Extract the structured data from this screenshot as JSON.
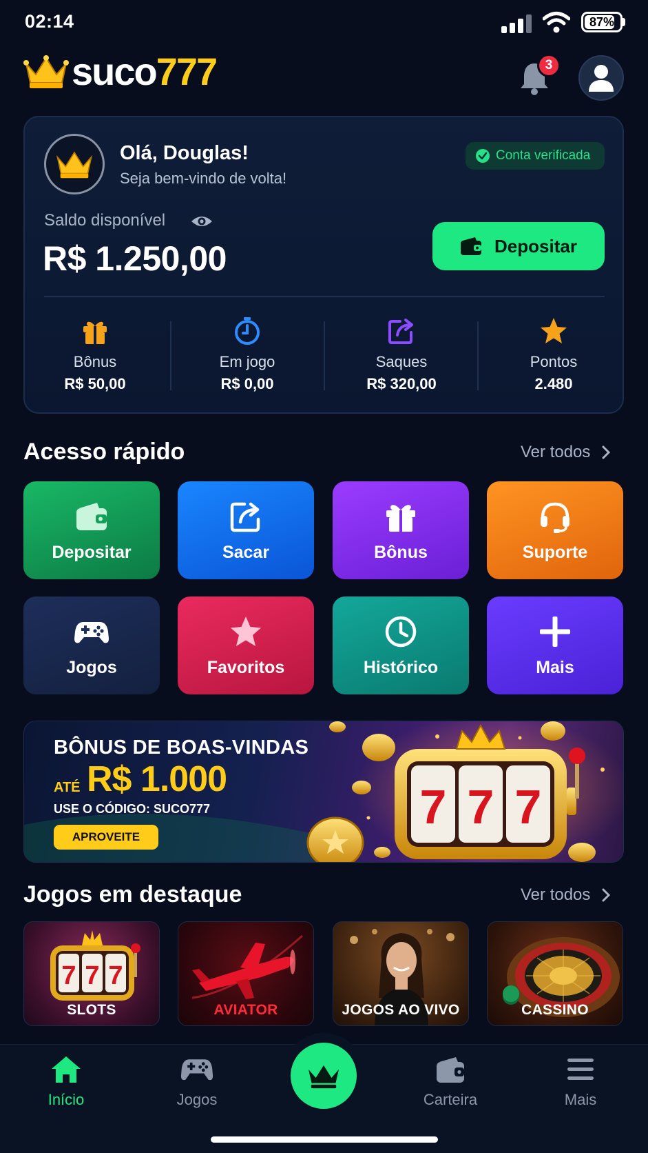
{
  "status_bar": {
    "time": "02:14",
    "battery": "87%",
    "battery_level": 0.87
  },
  "header": {
    "logo_white": "suco",
    "logo_yellow": "777",
    "notification_count": "3"
  },
  "balance_card": {
    "greeting": "Olá, Douglas!",
    "welcome": "Seja bem-vindo de volta!",
    "verified_label": "Conta verificada",
    "saldo_label": "Saldo disponível",
    "saldo_value": "R$ 1.250,00",
    "deposit_label": "Depositar",
    "stats": [
      {
        "label": "Bônus",
        "value": "R$ 50,00",
        "icon": "gift-icon",
        "color": "#f7a21b"
      },
      {
        "label": "Em jogo",
        "value": "R$ 0,00",
        "icon": "timer-icon",
        "color": "#2e8cff"
      },
      {
        "label": "Saques",
        "value": "R$ 320,00",
        "icon": "share-icon",
        "color": "#8b4dff"
      },
      {
        "label": "Pontos",
        "value": "2.480",
        "icon": "star-icon",
        "color": "#f7a21b"
      }
    ]
  },
  "quick_access": {
    "title": "Acesso rápido",
    "see_all": "Ver todos",
    "tiles": [
      {
        "label": "Depositar",
        "icon": "wallet-icon",
        "color": "#12a05a"
      },
      {
        "label": "Sacar",
        "icon": "withdraw-icon",
        "color": "#0f6ef0"
      },
      {
        "label": "Bônus",
        "icon": "gift-icon",
        "color": "#8a2ff0"
      },
      {
        "label": "Suporte",
        "icon": "headset-icon",
        "color": "#f07d16"
      },
      {
        "label": "Jogos",
        "icon": "gamepad-icon",
        "color": "#1a2a52"
      },
      {
        "label": "Favoritos",
        "icon": "star-icon",
        "color": "#d81f55"
      },
      {
        "label": "Histórico",
        "icon": "clock-icon",
        "color": "#0f9a8a"
      },
      {
        "label": "Mais",
        "icon": "plus-icon",
        "color": "#5a2ef0"
      }
    ]
  },
  "banner": {
    "title": "BÔNUS DE BOAS-VINDAS",
    "ate": "ATÉ",
    "amount": "R$ 1.000",
    "code_text": "USE O CÓDIGO: SUCO777",
    "cta": "APROVEITE"
  },
  "featured": {
    "title": "Jogos em destaque",
    "see_all": "Ver todos",
    "games": [
      {
        "label": "SLOTS"
      },
      {
        "label": "AVIATOR",
        "color": "#ff2a3a"
      },
      {
        "label": "JOGOS AO VIVO"
      },
      {
        "label": "CASSINO"
      }
    ]
  },
  "bottom_nav": {
    "items": [
      {
        "label": "Início",
        "icon": "home-icon"
      },
      {
        "label": "Jogos",
        "icon": "gamepad-icon"
      },
      {
        "label": "Carteira",
        "icon": "wallet-icon"
      },
      {
        "label": "Mais",
        "icon": "menu-icon"
      }
    ],
    "center_icon": "crown-icon"
  },
  "colors": {
    "accent_green": "#1ee882",
    "brand_yellow": "#ffcc1a",
    "background": "#070d1c"
  }
}
